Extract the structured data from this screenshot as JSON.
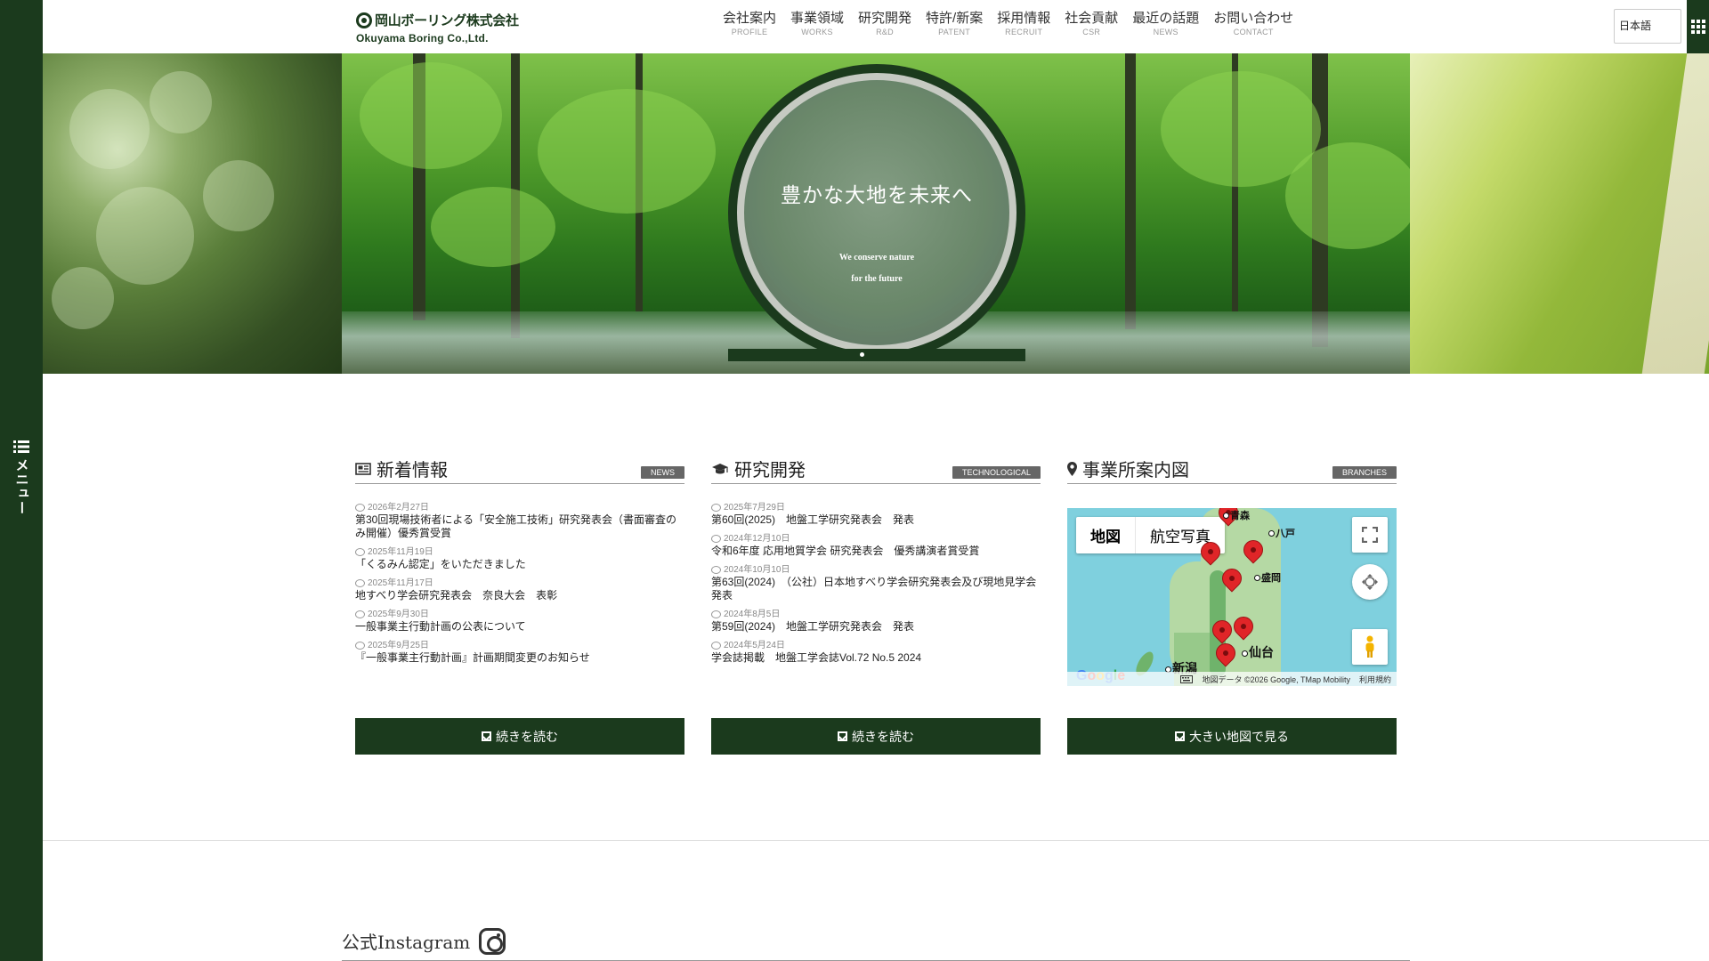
{
  "side_menu": {
    "label": "メニュー"
  },
  "header": {
    "logo_jp": "岡山ボーリング株式会社",
    "logo_en": "Okuyama Boring Co.,Ltd.",
    "nav": [
      {
        "jp": "会社案内",
        "en": "PROFILE"
      },
      {
        "jp": "事業領域",
        "en": "WORKS"
      },
      {
        "jp": "研究開発",
        "en": "R&D"
      },
      {
        "jp": "特許/新案",
        "en": "PATENT"
      },
      {
        "jp": "採用情報",
        "en": "RECRUIT"
      },
      {
        "jp": "社会貢献",
        "en": "CSR"
      },
      {
        "jp": "最近の話題",
        "en": "NEWS"
      },
      {
        "jp": "お問い合わせ",
        "en": "CONTACT"
      }
    ],
    "language": "日本語"
  },
  "hero": {
    "title": "豊かな大地を未来へ",
    "subtitle_line1": "We conserve nature",
    "subtitle_line2": "for the future"
  },
  "news": {
    "title": "新着情報",
    "badge": "NEWS",
    "items": [
      {
        "date": "2026年2月27日",
        "text": "第30回現場技術者による「安全施工技術」研究発表会（書面審査のみ開催）優秀賞受賞"
      },
      {
        "date": "2025年11月19日",
        "text": "「くるみん認定」をいただきました"
      },
      {
        "date": "2025年11月17日",
        "text": "地すべり学会研究発表会　奈良大会　表彰"
      },
      {
        "date": "2025年9月30日",
        "text": "一般事業主行動計画の公表について"
      },
      {
        "date": "2025年9月25日",
        "text": "『一般事業主行動計画』計画期間変更のお知らせ"
      }
    ],
    "button": "続きを読む"
  },
  "research": {
    "title": "研究開発",
    "badge": "TECHNOLOGICAL",
    "items": [
      {
        "date": "2025年7月29日",
        "text": "第60回(2025)　地盤工学研究発表会　発表"
      },
      {
        "date": "2024年12月10日",
        "text": "令和6年度 応用地質学会 研究発表会　優秀講演者賞受賞"
      },
      {
        "date": "2024年10月10日",
        "text": "第63回(2024)　（公社）日本地すべり学会研究発表会及び現地見学会　発表"
      },
      {
        "date": "2024年8月5日",
        "text": "第59回(2024)　地盤工学研究発表会　発表"
      },
      {
        "date": "2024年5月24日",
        "text": "学会誌掲載　地盤工学会誌Vol.72 No.5 2024"
      }
    ],
    "button": "続きを読む"
  },
  "branches": {
    "title": "事業所案内図",
    "badge": "BRANCHES",
    "map": {
      "tab_map": "地図",
      "tab_satellite": "航空写真",
      "cities": [
        "青森",
        "八戸",
        "盛岡",
        "仙台",
        "新潟"
      ],
      "attribution": "地図データ ©2026 Google, TMap Mobility",
      "terms": "利用規約",
      "google": [
        "G",
        "o",
        "o",
        "g",
        "l",
        "e"
      ]
    },
    "button": "大きい地図で見る"
  },
  "instagram": {
    "title": "公式Instagram"
  },
  "colors": {
    "brand_green": "#1b3a1d",
    "badge_gray": "#666666",
    "pin_red": "#e02528"
  }
}
